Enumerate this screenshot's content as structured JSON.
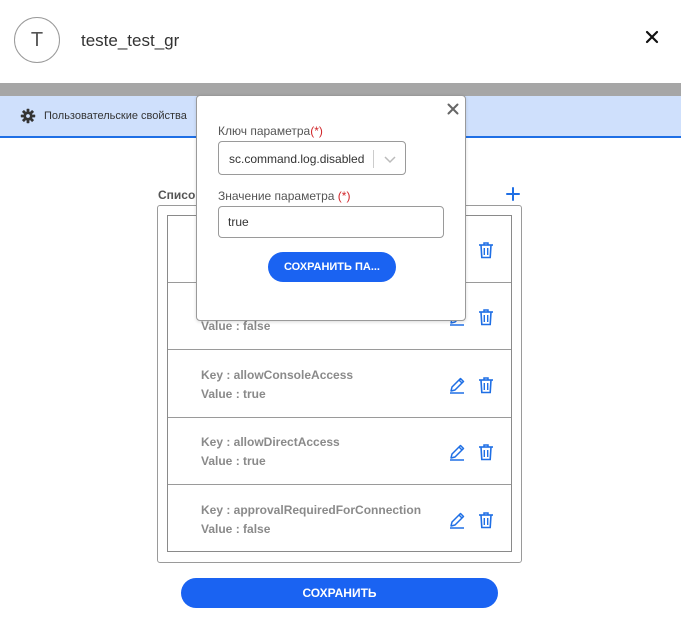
{
  "header": {
    "avatar_letter": "T",
    "title": "teste_test_gr",
    "close_symbol": "✕"
  },
  "tab": {
    "icon": "gear-icon",
    "label": "Пользовательские свойства"
  },
  "list": {
    "title": "Список",
    "add_icon": "plus-icon",
    "rows": [
      {
        "key": "",
        "value": ""
      },
      {
        "key": "",
        "value": "Value : false"
      },
      {
        "key": "Key : allowConsoleAccess",
        "value": "Value : true"
      },
      {
        "key": "Key : allowDirectAccess",
        "value": "Value : true"
      },
      {
        "key": "Key : approvalRequiredForConnection",
        "value": "Value : false"
      }
    ]
  },
  "save_button": "СОХРАНИТЬ",
  "modal": {
    "key_label": "Ключ параметра",
    "key_required": "(*)",
    "key_value": "sc.command.log.disabled",
    "value_label": "Значение параметра ",
    "value_required": "(*)",
    "value_value": "true",
    "save_button": "СОХРАНИТЬ ПА..."
  },
  "colors": {
    "accent": "#1a63f2",
    "tab_bg": "#cfe0fc",
    "required": "#d0262a",
    "icon_blue": "#1f6fe5"
  }
}
